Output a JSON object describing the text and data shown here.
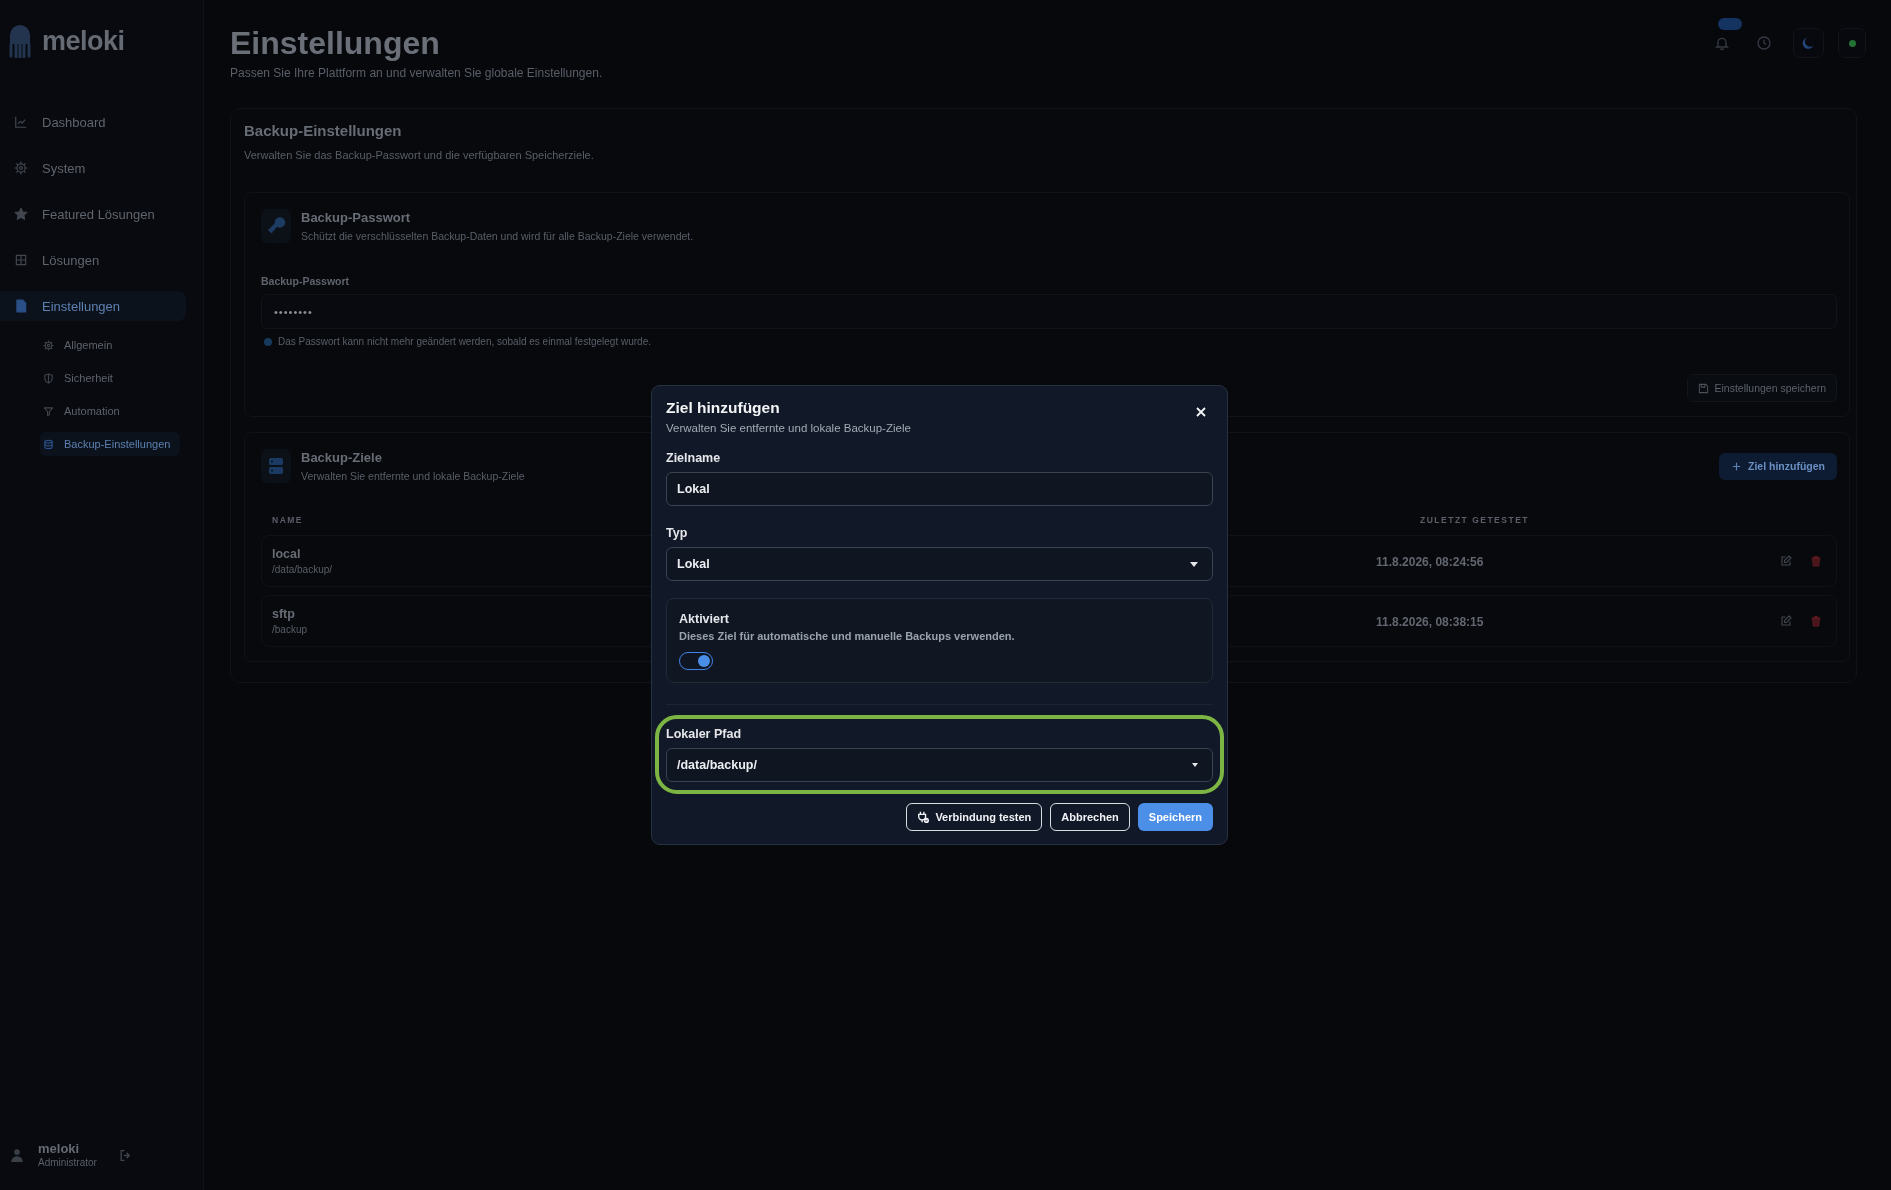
{
  "sidebar": {
    "logo": "meloki",
    "items": [
      {
        "label": "Dashboard",
        "selected": false
      },
      {
        "label": "System",
        "selected": false
      },
      {
        "label": "Featured Lösungen",
        "selected": false
      },
      {
        "label": "Lösungen",
        "selected": false
      },
      {
        "label": "Einstellungen",
        "selected": true,
        "children": [
          {
            "label": "Allgemein",
            "selected": false
          },
          {
            "label": "Sicherheit",
            "selected": false
          },
          {
            "label": "Automation",
            "selected": false
          },
          {
            "label": "Backup-Einstellungen",
            "selected": true
          }
        ]
      }
    ],
    "user": {
      "name": "meloki",
      "role": "Administrator"
    }
  },
  "header": {
    "title": "Einstellungen",
    "subtitle": "Passen Sie Ihre Plattform an und verwalten Sie globale Einstellungen."
  },
  "backup_settings": {
    "title": "Backup-Einstellungen",
    "subtitle": "Verwalten Sie das Backup-Passwort und die verfügbaren Speicherziele.",
    "password": {
      "title": "Backup-Passwort",
      "subtitle": "Schützt die verschlüsselten Backup-Daten und wird für alle Backup-Ziele verwendet.",
      "field_label": "Backup-Passwort",
      "value": "••••••••",
      "hint": "Das Passwort kann nicht mehr geändert werden, sobald es einmal festgelegt wurde.",
      "save_button": "Einstellungen speichern"
    },
    "targets": {
      "title": "Backup-Ziele",
      "subtitle": "Verwalten Sie entfernte und lokale Backup-Ziele",
      "add_button": "Ziel hinzufügen",
      "columns": [
        "NAME",
        "ZULETZT GETESTET"
      ],
      "rows": [
        {
          "name": "local",
          "path": "/data/backup/",
          "last_tested": "11.8.2026, 08:24:56"
        },
        {
          "name": "sftp",
          "path": "/backup",
          "last_tested": "11.8.2026, 08:38:15"
        }
      ]
    }
  },
  "dialog": {
    "title": "Ziel hinzufügen",
    "subtitle": "Verwalten Sie entfernte und lokale Backup-Ziele",
    "fields": [
      {
        "kind": "text",
        "label": "Zielname",
        "value": "Lokal"
      },
      {
        "kind": "select",
        "label": "Typ",
        "value": "Lokal"
      }
    ],
    "enabled": {
      "title": "Aktiviert",
      "description": "Dieses Ziel für automatische und manuelle Backups verwenden.",
      "on": true
    },
    "path_field": {
      "label": "Lokaler Pfad",
      "value": "/data/backup/",
      "highlighted": true
    },
    "buttons": [
      {
        "kind": "test",
        "label": "Verbindung testen"
      },
      {
        "kind": "outline",
        "label": "Abbrechen"
      },
      {
        "kind": "primary",
        "label": "Speichern"
      }
    ]
  }
}
